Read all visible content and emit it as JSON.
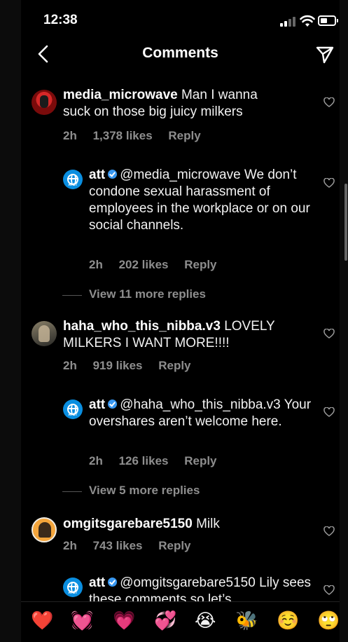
{
  "status": {
    "time": "12:38"
  },
  "nav": {
    "title": "Comments"
  },
  "comments": [
    {
      "username": "media_microwave",
      "text": "Man I wanna suck on those big juicy milkers",
      "age": "2h",
      "likes": "1,378 likes",
      "reply": "Reply"
    },
    {
      "username": "att",
      "text": "@media_microwave We don’t condone sexual harassment of employees in the workplace or on our social channels.",
      "age": "2h",
      "likes": "202 likes",
      "reply": "Reply",
      "verified": true
    },
    {
      "view_more": "View 11 more replies"
    },
    {
      "username": "haha_who_this_nibba.v3",
      "text": "LOVELY MILKERS I WANT MORE!!!!",
      "age": "2h",
      "likes": "919 likes",
      "reply": "Reply"
    },
    {
      "username": "att",
      "text": "@haha_who_this_nibba.v3 Your overshares aren’t welcome here.",
      "age": "2h",
      "likes": "126 likes",
      "reply": "Reply",
      "verified": true
    },
    {
      "view_more": "View 5 more replies"
    },
    {
      "username": "omgitsgarebare5150",
      "text": "Milk",
      "age": "2h",
      "likes": "743 likes",
      "reply": "Reply"
    },
    {
      "username": "att",
      "text": "@omgitsgarebare5150 Lily sees these comments so let’s",
      "verified": true
    }
  ],
  "att_avatar_text": "AT&T",
  "emoji_bar": [
    "❤️",
    "💓",
    "💗",
    "💞",
    "😭",
    "🐝",
    "☺️",
    "🙄"
  ],
  "colors": {
    "background": "#000000",
    "muted": "#8e8e8e",
    "verified": "#3897f0",
    "att_blue": "#0a8ee0"
  }
}
